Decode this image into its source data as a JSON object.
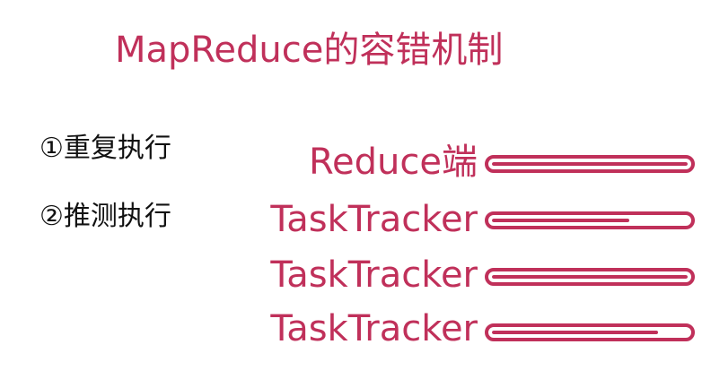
{
  "slide": {
    "title": "MapReduce的容错机制",
    "points": [
      "①重复执行",
      "②推测执行"
    ],
    "rows": [
      {
        "label": "Reduce端",
        "progress": 1.0
      },
      {
        "label": "TaskTracker",
        "progress": 0.7
      },
      {
        "label": "TaskTracker",
        "progress": 1.0
      },
      {
        "label": "TaskTracker",
        "progress": 0.85
      }
    ]
  },
  "colors": {
    "accent": "#c0305a",
    "text": "#111111",
    "background": "#ffffff"
  }
}
